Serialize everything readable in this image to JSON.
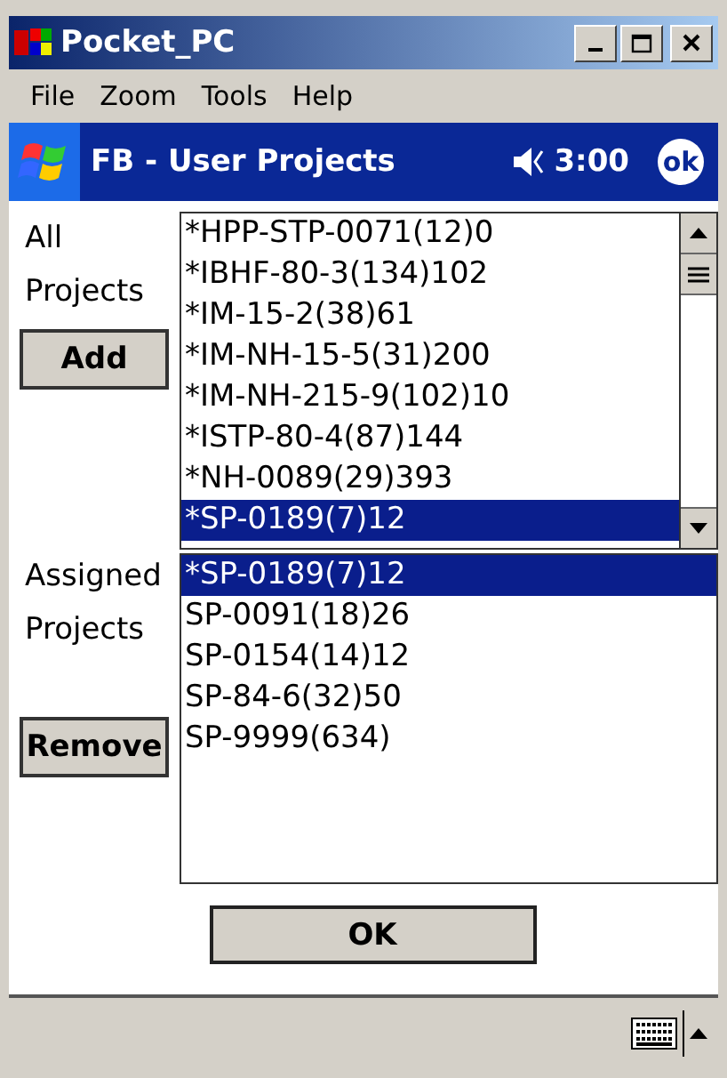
{
  "window": {
    "title": "Pocket_PC"
  },
  "menu": [
    "File",
    "Zoom",
    "Tools",
    "Help"
  ],
  "nav_bar": {
    "title": "FB - User Projects",
    "time": "3:00",
    "ok": "ok"
  },
  "all_projects": {
    "label_lines": [
      "All",
      "Projects"
    ],
    "button": "Add",
    "items": [
      {
        "text": "*HPP-STP-0071(12)0",
        "selected": false
      },
      {
        "text": "*IBHF-80-3(134)102",
        "selected": false
      },
      {
        "text": "*IM-15-2(38)61",
        "selected": false
      },
      {
        "text": "*IM-NH-15-5(31)200",
        "selected": false
      },
      {
        "text": "*IM-NH-215-9(102)10",
        "selected": false
      },
      {
        "text": "*ISTP-80-4(87)144",
        "selected": false
      },
      {
        "text": "*NH-0089(29)393",
        "selected": false
      },
      {
        "text": "*SP-0189(7)12",
        "selected": true
      }
    ]
  },
  "assigned_projects": {
    "label_lines": [
      "Assigned",
      "Projects"
    ],
    "button": "Remove",
    "items": [
      {
        "text": "*SP-0189(7)12",
        "selected": true
      },
      {
        "text": "SP-0091(18)26",
        "selected": false
      },
      {
        "text": "SP-0154(14)12",
        "selected": false
      },
      {
        "text": "SP-84-6(32)50",
        "selected": false
      },
      {
        "text": "SP-9999(634)",
        "selected": false
      }
    ]
  },
  "ok_button": "OK"
}
